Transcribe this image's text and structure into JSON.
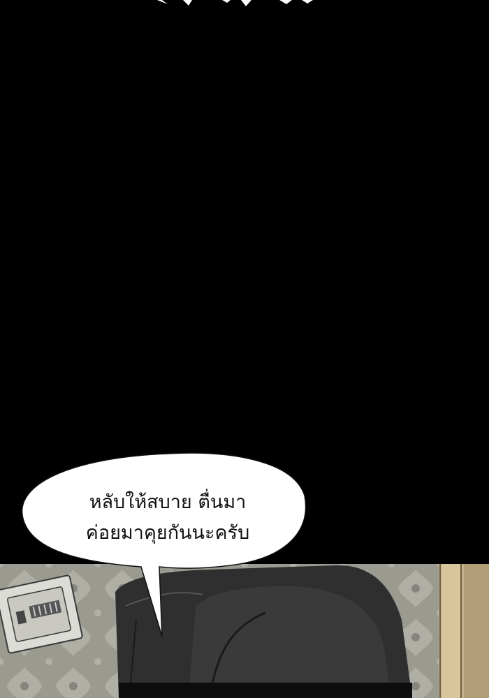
{
  "speech_bubble": {
    "line_1": "หลับให้สบาย ตื่นมา",
    "line_2": "ค่อยมาคุยกันนะครับ"
  },
  "colors": {
    "background": "#000000",
    "wall": "#9b9b92",
    "bubble_fill": "#ffffff",
    "character_coat": "#2e2e2e"
  }
}
